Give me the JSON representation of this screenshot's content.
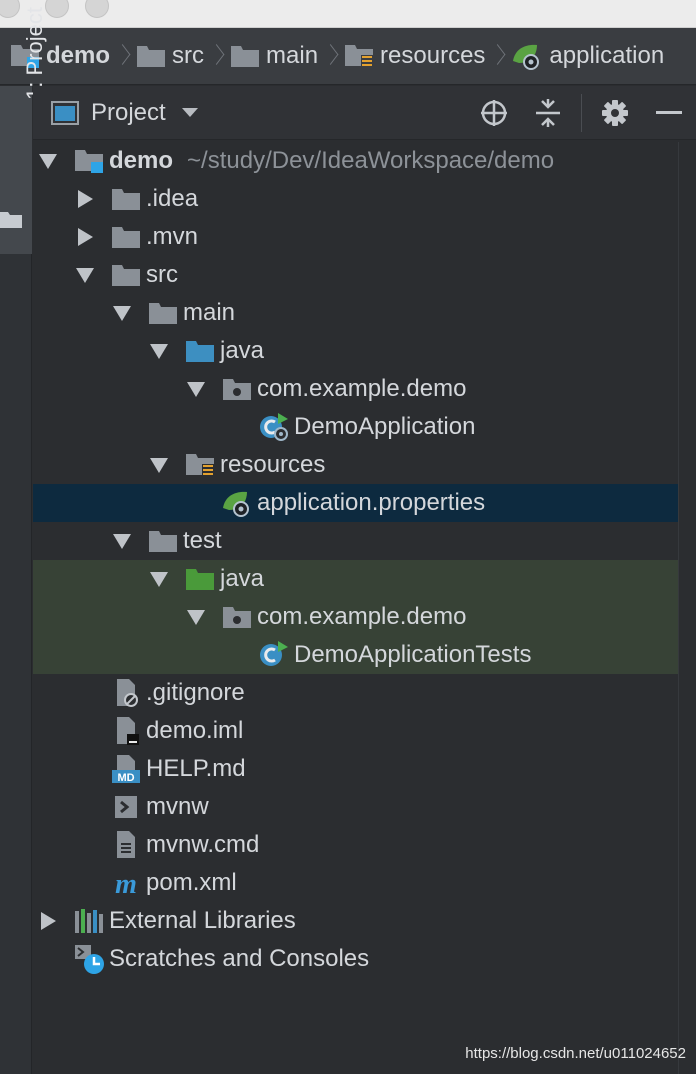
{
  "window": {
    "title": ""
  },
  "breadcrumb": [
    {
      "label": "demo",
      "icon": "module-folder-icon",
      "bold": true
    },
    {
      "label": "src",
      "icon": "folder-icon",
      "bold": false
    },
    {
      "label": "main",
      "icon": "folder-icon",
      "bold": false
    },
    {
      "label": "resources",
      "icon": "resources-folder-icon",
      "bold": false
    },
    {
      "label": "application",
      "icon": "spring-properties-icon",
      "bold": false
    }
  ],
  "left_strip": {
    "tab_number": "1",
    "tab_label": ": Project"
  },
  "panel": {
    "title": "Project",
    "actions": [
      "locate-icon",
      "collapse-all-icon",
      "gear-icon",
      "minimize-icon"
    ]
  },
  "tree": [
    {
      "label": "demo",
      "path": "~/study/Dev/IdeaWorkspace/demo",
      "level": 0,
      "arrow": "down",
      "icon": "module",
      "bold": true,
      "state": ""
    },
    {
      "label": ".idea",
      "path": "",
      "level": 1,
      "arrow": "right",
      "icon": "folder",
      "bold": false,
      "state": ""
    },
    {
      "label": ".mvn",
      "path": "",
      "level": 1,
      "arrow": "right",
      "icon": "folder",
      "bold": false,
      "state": ""
    },
    {
      "label": "src",
      "path": "",
      "level": 1,
      "arrow": "down",
      "icon": "folder",
      "bold": false,
      "state": ""
    },
    {
      "label": "main",
      "path": "",
      "level": 2,
      "arrow": "down",
      "icon": "folder",
      "bold": false,
      "state": ""
    },
    {
      "label": "java",
      "path": "",
      "level": 3,
      "arrow": "down",
      "icon": "source-folder",
      "bold": false,
      "state": ""
    },
    {
      "label": "com.example.demo",
      "path": "",
      "level": 4,
      "arrow": "down",
      "icon": "package",
      "bold": false,
      "state": ""
    },
    {
      "label": "DemoApplication",
      "path": "",
      "level": 5,
      "arrow": "none",
      "icon": "spring-class",
      "bold": false,
      "state": ""
    },
    {
      "label": "resources",
      "path": "",
      "level": 3,
      "arrow": "down",
      "icon": "resources-folder",
      "bold": false,
      "state": ""
    },
    {
      "label": "application.properties",
      "path": "",
      "level": 4,
      "arrow": "none",
      "icon": "spring-properties",
      "bold": false,
      "state": "selected"
    },
    {
      "label": "test",
      "path": "",
      "level": 2,
      "arrow": "down",
      "icon": "folder",
      "bold": false,
      "state": ""
    },
    {
      "label": "java",
      "path": "",
      "level": 3,
      "arrow": "down",
      "icon": "test-folder",
      "bold": false,
      "state": "test"
    },
    {
      "label": "com.example.demo",
      "path": "",
      "level": 4,
      "arrow": "down",
      "icon": "package",
      "bold": false,
      "state": "test"
    },
    {
      "label": "DemoApplicationTests",
      "path": "",
      "level": 5,
      "arrow": "none",
      "icon": "test-class",
      "bold": false,
      "state": "test"
    },
    {
      "label": ".gitignore",
      "path": "",
      "level": 1,
      "arrow": "none",
      "icon": "ignore-file",
      "bold": false,
      "state": ""
    },
    {
      "label": "demo.iml",
      "path": "",
      "level": 1,
      "arrow": "none",
      "icon": "iml-file",
      "bold": false,
      "state": ""
    },
    {
      "label": "HELP.md",
      "path": "",
      "level": 1,
      "arrow": "none",
      "icon": "markdown-file",
      "bold": false,
      "state": ""
    },
    {
      "label": "mvnw",
      "path": "",
      "level": 1,
      "arrow": "none",
      "icon": "shell-file",
      "bold": false,
      "state": ""
    },
    {
      "label": "mvnw.cmd",
      "path": "",
      "level": 1,
      "arrow": "none",
      "icon": "text-file",
      "bold": false,
      "state": ""
    },
    {
      "label": "pom.xml",
      "path": "",
      "level": 1,
      "arrow": "none",
      "icon": "maven-file",
      "bold": false,
      "state": ""
    },
    {
      "label": "External Libraries",
      "path": "",
      "level": 0,
      "arrow": "right",
      "icon": "libraries",
      "bold": false,
      "state": ""
    },
    {
      "label": "Scratches and Consoles",
      "path": "",
      "level": 0,
      "arrow": "none",
      "icon": "scratches",
      "bold": false,
      "state": ""
    }
  ],
  "watermark": "https://blog.csdn.net/u011024652",
  "colors": {
    "background": "#2b2d30",
    "selected_row": "#0d2a3f",
    "test_row": "#374236",
    "folder": "#8a9097",
    "source_folder": "#3d8fc1",
    "test_folder": "#4a9a3a",
    "spring_green": "#5aa343",
    "resources_yellow": "#e3a12f"
  }
}
